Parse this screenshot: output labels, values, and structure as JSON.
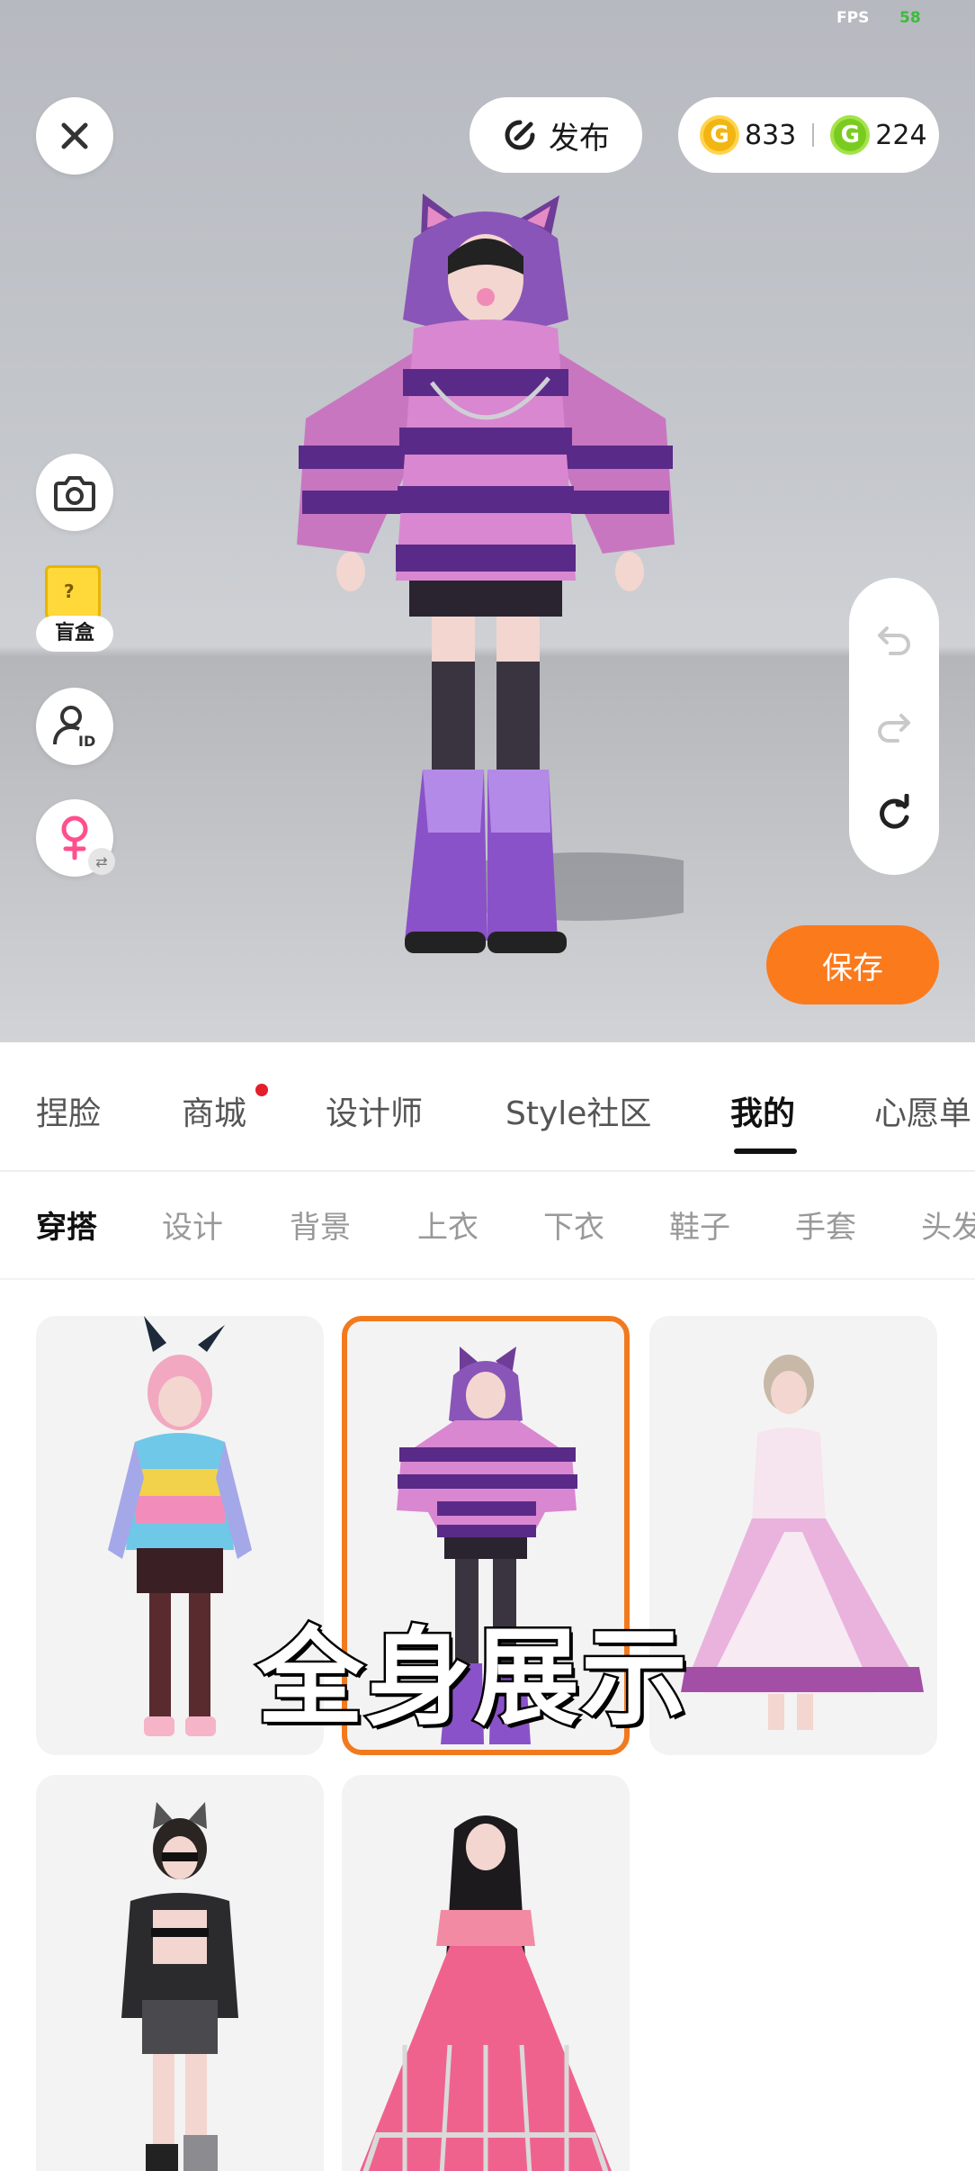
{
  "status": {
    "fps_label": "FPS",
    "fps_value": "58"
  },
  "header": {
    "close_icon": "close-icon",
    "publish_label": "发布",
    "coins": [
      {
        "icon": "gold-coin-icon",
        "symbol": "G",
        "value": "833",
        "color": "#f2b512"
      },
      {
        "icon": "green-coin-icon",
        "symbol": "G",
        "value": "224",
        "color": "#7acb20"
      }
    ]
  },
  "left_tools": {
    "camera": "camera-icon",
    "blind_box_label": "盲盒",
    "id_card": "user-id-icon",
    "gender": "female-icon"
  },
  "history_controls": [
    "undo-icon",
    "redo-icon",
    "reset-icon"
  ],
  "save_label": "保存",
  "main_tabs": [
    "捏脸",
    "商城",
    "设计师",
    "Style社区",
    "我的",
    "心愿单"
  ],
  "main_tabs_active": "我的",
  "sub_tabs": [
    "穿搭",
    "设计",
    "背景",
    "上衣",
    "下衣",
    "鞋子",
    "手套",
    "头发"
  ],
  "sub_tabs_active": "穿搭",
  "overlay_caption": "全身展示",
  "colors": {
    "accent": "#fb7a1c",
    "selected_border": "#f27a1e",
    "notification_dot": "#e41e2b"
  }
}
